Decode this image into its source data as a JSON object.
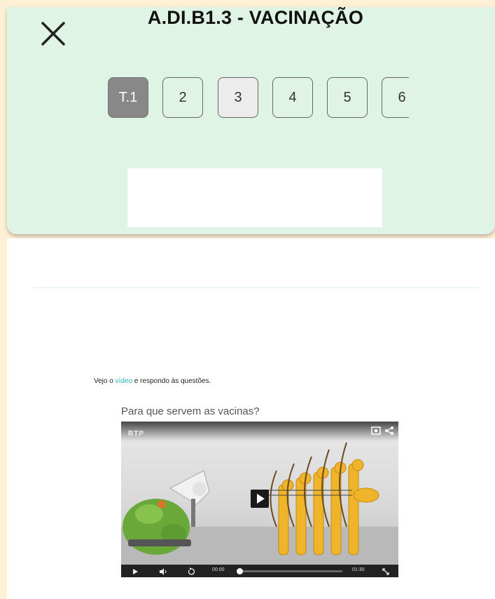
{
  "header": {
    "title": "A.DI.B1.3 - VACINAÇÃO",
    "close_icon": "close-icon",
    "tabs": [
      {
        "label": "T.1",
        "state": "active"
      },
      {
        "label": "2",
        "state": "default"
      },
      {
        "label": "3",
        "state": "shaded"
      },
      {
        "label": "4",
        "state": "default"
      },
      {
        "label": "5",
        "state": "default"
      },
      {
        "label": "6",
        "state": "default"
      }
    ]
  },
  "content": {
    "instruction": {
      "before": "Vejo o ",
      "link": "vídeo",
      "after": " e respondo às questões."
    },
    "video": {
      "title": "Para que servem as vacinas?",
      "logo": "RTP",
      "time_current": "00:00",
      "time_total": "01:30",
      "progress": 0.02,
      "icons": [
        "watch-later-icon",
        "share-icon",
        "play-icon",
        "volume-icon",
        "replay-icon",
        "fullscreen-icon"
      ]
    }
  },
  "colors": {
    "page_background": "#fdf0d5",
    "header_background": "#dff4e5",
    "active_tab": "#888888",
    "link": "#2bb6b6"
  }
}
